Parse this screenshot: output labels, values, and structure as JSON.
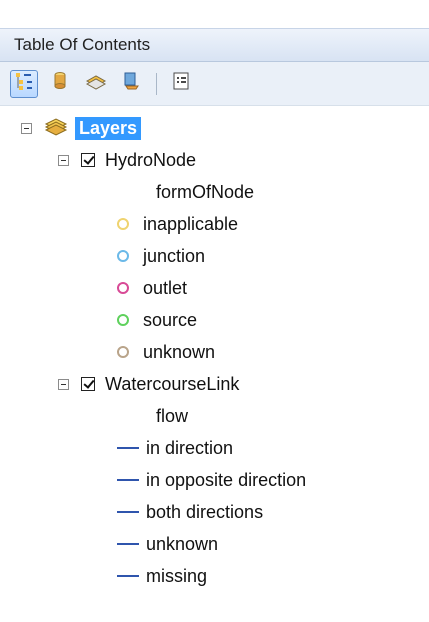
{
  "panel": {
    "title": "Table Of Contents"
  },
  "toolbar": {
    "buttons": [
      {
        "name": "list-by-drawing-order",
        "icon": "list-by-drawing-order-icon"
      },
      {
        "name": "list-by-source",
        "icon": "database-source-icon"
      },
      {
        "name": "list-by-visibility",
        "icon": "layer-visibility-icon"
      },
      {
        "name": "list-by-selection",
        "icon": "selection-icon"
      },
      {
        "name": "options",
        "icon": "options-icon"
      }
    ]
  },
  "tree": {
    "root_label": "Layers",
    "layers": [
      {
        "name": "HydroNode",
        "field": "formOfNode",
        "items": [
          {
            "label": "inapplicable",
            "color": "#efd36f"
          },
          {
            "label": "junction",
            "color": "#6bb9e8"
          },
          {
            "label": "outlet",
            "color": "#d84a96"
          },
          {
            "label": "source",
            "color": "#5fd15d"
          },
          {
            "label": "unknown",
            "color": "#b9a48a"
          }
        ]
      },
      {
        "name": "WatercourseLink",
        "field": "flow",
        "items": [
          {
            "label": "in direction",
            "color": "#2f55ad"
          },
          {
            "label": "in opposite direction",
            "color": "#2f55ad"
          },
          {
            "label": "both directions",
            "color": "#2f55ad"
          },
          {
            "label": "unknown",
            "color": "#2f55ad"
          },
          {
            "label": "missing",
            "color": "#2f55ad"
          }
        ]
      }
    ]
  }
}
